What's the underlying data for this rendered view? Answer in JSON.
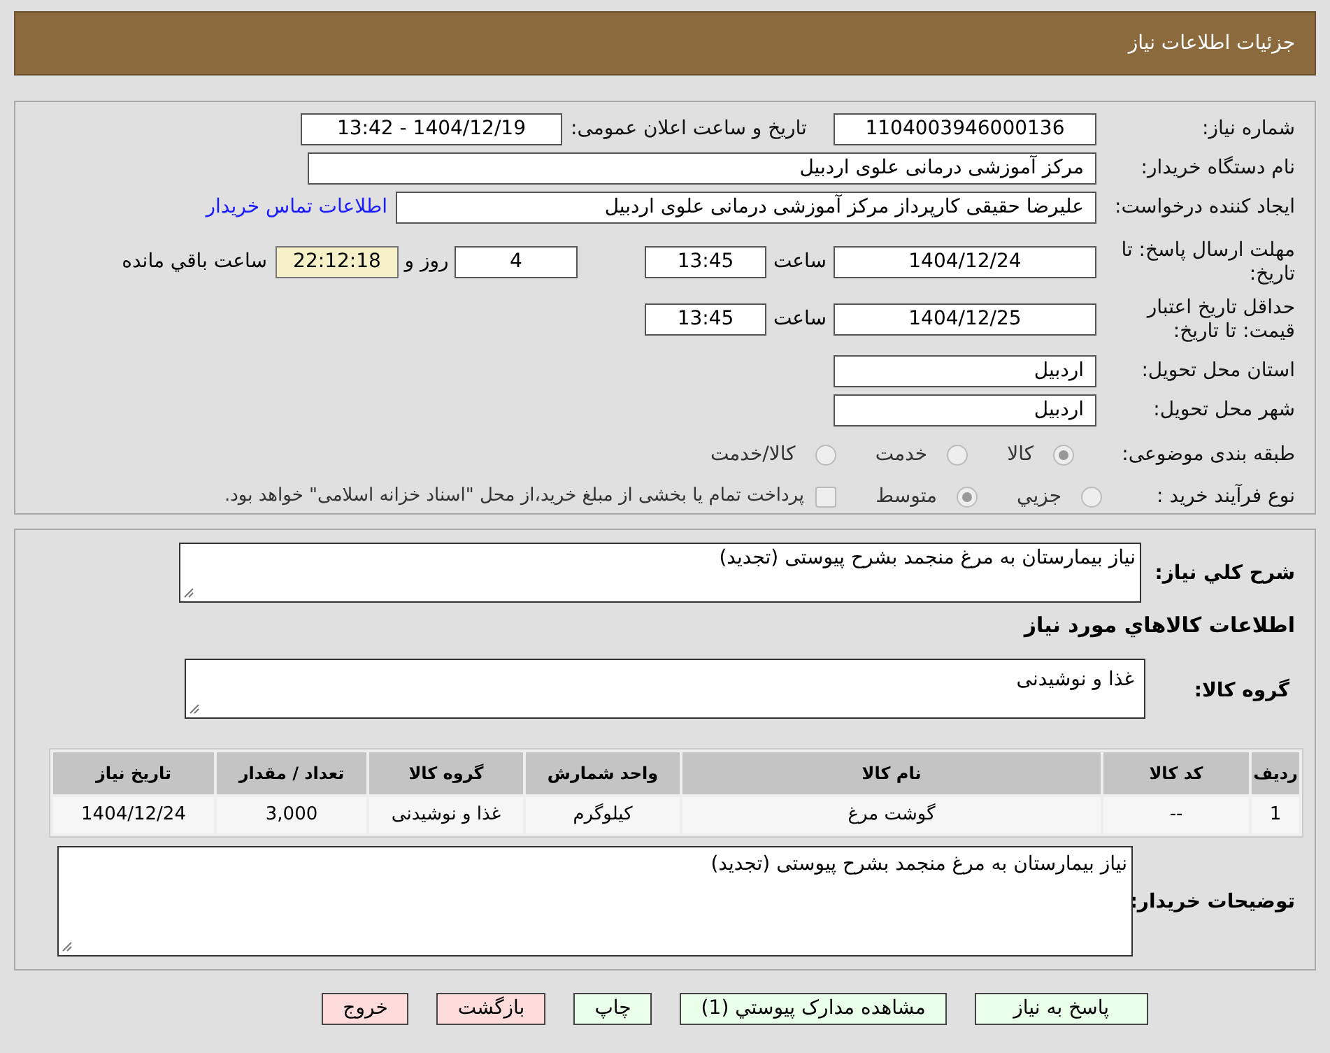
{
  "header": {
    "title": "جزئیات اطلاعات نیاز"
  },
  "details": {
    "need_number": {
      "label": "شماره نیاز:",
      "value": "1104003946000136"
    },
    "announce": {
      "label": "تاریخ و ساعت اعلان عمومی:",
      "value": "1404/12/19 - 13:42"
    },
    "buyer": {
      "label": "نام دستگاه خریدار:",
      "value": "مرکز آموزشی درمانی علوی اردبیل"
    },
    "requester": {
      "label": "ایجاد کننده درخواست:",
      "value": "علیرضا حقیقی کارپرداز مرکز آموزشی درمانی علوی اردبیل",
      "link": "اطلاعات تماس خریدار"
    },
    "deadline": {
      "label": "مهلت ارسال پاسخ: تا تاریخ:",
      "date": "1404/12/24",
      "time_label": "ساعت",
      "time": "13:45",
      "days": "4",
      "days_label": "روز و",
      "remaining": "22:12:18",
      "remaining_label": "ساعت باقي مانده"
    },
    "validity": {
      "label": "حداقل تاریخ اعتبار قیمت: تا تاریخ:",
      "date": "1404/12/25",
      "time_label": "ساعت",
      "time": "13:45"
    },
    "province": {
      "label": "استان محل تحویل:",
      "value": "اردبیل"
    },
    "city": {
      "label": "شهر محل تحویل:",
      "value": "اردبیل"
    },
    "category": {
      "label": "طبقه بندی موضوعی:",
      "options": [
        {
          "label": "کالا",
          "selected": true
        },
        {
          "label": "خدمت",
          "selected": false
        },
        {
          "label": "کالا/خدمت",
          "selected": false
        }
      ]
    },
    "process": {
      "label": "نوع فرآیند خرید :",
      "options": [
        {
          "label": "جزيي",
          "selected": false
        },
        {
          "label": "متوسط",
          "selected": true
        }
      ],
      "payment": {
        "text": "پرداخت تمام یا بخشی از مبلغ خرید،از محل \"اسناد خزانه اسلامی\" خواهد بود.",
        "checked": false
      }
    }
  },
  "goods": {
    "summary": {
      "label": "شرح کلي نیاز:",
      "value": "نیاز بیمارستان به مرغ منجمد بشرح پیوستی (تجدید)"
    },
    "heading": "اطلاعات کالاهاي مورد نیاز",
    "group": {
      "label": "گروه کالا:",
      "value": "غذا و نوشیدنی"
    },
    "table": {
      "columns": [
        "ردیف",
        "کد کالا",
        "نام کالا",
        "واحد شمارش",
        "گروه کالا",
        "تعداد / مقدار",
        "تاریخ نیاز"
      ],
      "rows": [
        [
          "1",
          "--",
          "گوشت مرغ",
          "کیلوگرم",
          "غذا و نوشیدنی",
          "3,000",
          "1404/12/24"
        ]
      ]
    },
    "notes": {
      "label": "توضیحات خریدار:",
      "value": "نیاز بیمارستان به مرغ منجمد بشرح پیوستی (تجدید)"
    }
  },
  "buttons": [
    {
      "label": "پاسخ به نیاز",
      "kind": "primary"
    },
    {
      "label": "مشاهده مدارک پیوستي (1)",
      "kind": "primary"
    },
    {
      "label": "چاپ",
      "kind": "primary"
    },
    {
      "label": "بازگشت",
      "kind": "danger"
    },
    {
      "label": "خروج",
      "kind": "danger"
    }
  ]
}
